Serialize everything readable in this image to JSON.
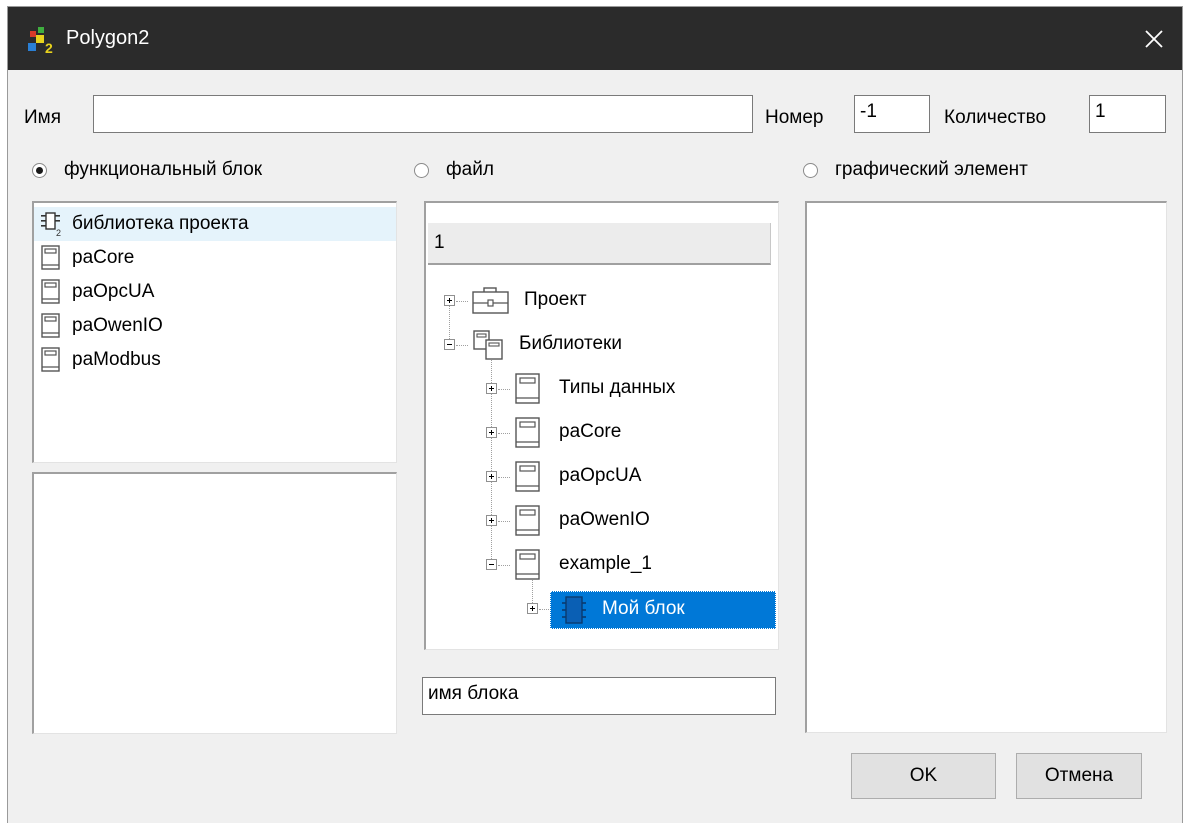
{
  "window": {
    "title": "Polygon2"
  },
  "form": {
    "name_label": "Имя",
    "name_value": "",
    "number_label": "Номер",
    "number_value": "-1",
    "count_label": "Количество",
    "count_value": "1"
  },
  "radios": {
    "function_block": {
      "label": "функциональный блок",
      "checked": true
    },
    "file": {
      "label": "файл",
      "checked": false
    },
    "graphic_element": {
      "label": "графический элемент",
      "checked": false
    }
  },
  "libraries": [
    {
      "label": "библиотека проекта",
      "icon": "project-library-icon",
      "selected": true
    },
    {
      "label": "paCore",
      "icon": "library-book-icon"
    },
    {
      "label": "paOpcUA",
      "icon": "library-book-icon"
    },
    {
      "label": "paOwenIO",
      "icon": "library-book-icon"
    },
    {
      "label": "paModbus",
      "icon": "library-book-icon"
    }
  ],
  "tree": {
    "header": "1",
    "nodes": [
      {
        "label": "Проект",
        "icon": "project-briefcase-icon",
        "expander": "plus"
      },
      {
        "label": "Библиотеки",
        "icon": "libraries-icon",
        "expander": "minus"
      },
      {
        "label": "Типы данных",
        "icon": "library-book-icon",
        "expander": "plus"
      },
      {
        "label": "paCore",
        "icon": "library-book-icon",
        "expander": "plus"
      },
      {
        "label": "paOpcUA",
        "icon": "library-book-icon",
        "expander": "plus"
      },
      {
        "label": "paOwenIO",
        "icon": "library-book-icon",
        "expander": "plus"
      },
      {
        "label": "example_1",
        "icon": "library-book-icon",
        "expander": "minus"
      },
      {
        "label": "Мой блок",
        "icon": "function-block-icon",
        "expander": "plus",
        "selected": true
      }
    ]
  },
  "block_name_value": "имя блока",
  "buttons": {
    "ok": "OK",
    "cancel": "Отмена"
  },
  "colors": {
    "titlebar": "#2b2b2b",
    "selection": "#0078d7",
    "list_hover": "#e5f3fb"
  }
}
